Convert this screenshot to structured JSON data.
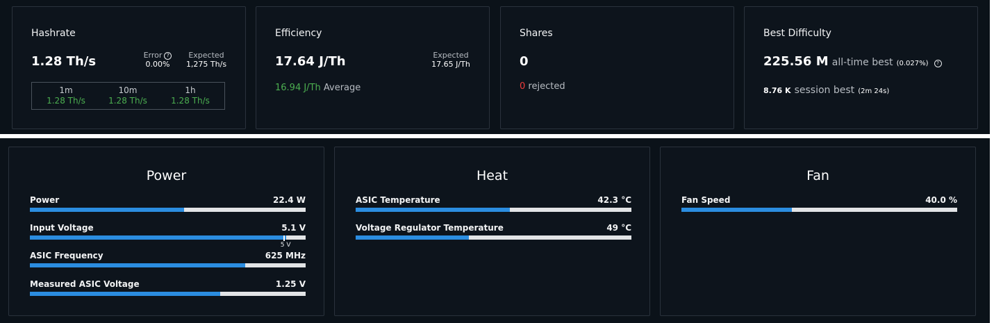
{
  "hashrate": {
    "title": "Hashrate",
    "value": "1.28 Th/s",
    "error_label": "Error",
    "error_value": "0.00%",
    "expected_label": "Expected",
    "expected_value": "1,275 Th/s",
    "windows": [
      {
        "label": "1m",
        "value": "1.28 Th/s"
      },
      {
        "label": "10m",
        "value": "1.28 Th/s"
      },
      {
        "label": "1h",
        "value": "1.28 Th/s"
      }
    ]
  },
  "efficiency": {
    "title": "Efficiency",
    "value": "17.64 J/Th",
    "expected_label": "Expected",
    "expected_value": "17.65 J/Th",
    "average_value": "16.94 J/Th",
    "average_label": "Average"
  },
  "shares": {
    "title": "Shares",
    "value": "0",
    "rejected_count": "0",
    "rejected_label": "rejected"
  },
  "best_difficulty": {
    "title": "Best Difficulty",
    "alltime_value": "225.56 M",
    "alltime_label": "all-time best",
    "alltime_pct": "(0.027%)",
    "session_value": "8.76 K",
    "session_label": "session best",
    "session_time": "(2m 24s)"
  },
  "power_panel": {
    "title": "Power",
    "metrics": [
      {
        "label": "Power",
        "value": "22.4 W",
        "fill_pct": 56
      },
      {
        "label": "Input Voltage",
        "value": "5.1 V",
        "fill_pct": 93,
        "marker_pct": 92,
        "marker_label": "5 V"
      },
      {
        "label": "ASIC Frequency",
        "value": "625 MHz",
        "fill_pct": 78
      },
      {
        "label": "Measured ASIC Voltage",
        "value": "1.25 V",
        "fill_pct": 69
      }
    ]
  },
  "heat_panel": {
    "title": "Heat",
    "metrics": [
      {
        "label": "ASIC Temperature",
        "value": "42.3 °C",
        "fill_pct": 56
      },
      {
        "label": "Voltage Regulator Temperature",
        "value": "49 °C",
        "fill_pct": 41
      }
    ]
  },
  "fan_panel": {
    "title": "Fan",
    "metrics": [
      {
        "label": "Fan Speed",
        "value": "40.0 %",
        "fill_pct": 40
      }
    ]
  },
  "colors": {
    "background": "#0b1219",
    "card": "#0d141c",
    "bar_fill": "#2b8de0",
    "bar_track": "#e2e4e6",
    "green": "#4caf50",
    "red": "#ef3b3b"
  },
  "icons": {
    "help": "question-circle-icon"
  }
}
